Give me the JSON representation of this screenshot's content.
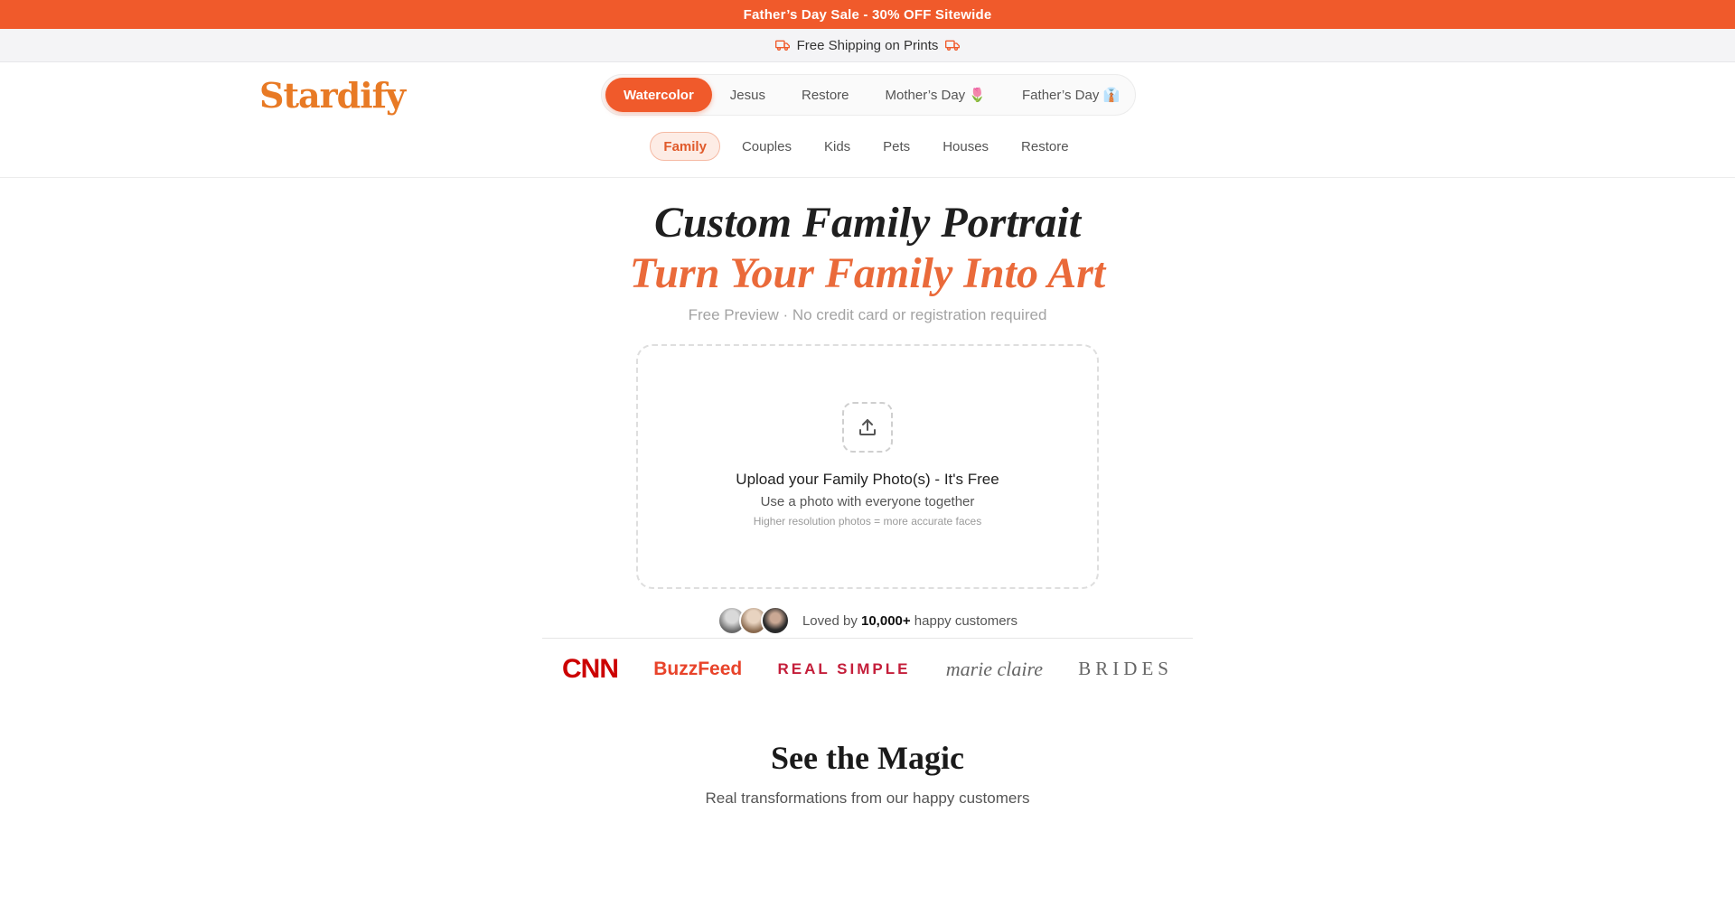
{
  "promo": {
    "text": "Father’s Day Sale - 30% OFF Sitewide"
  },
  "shipping": {
    "text": "Free Shipping on Prints"
  },
  "brand": {
    "logo": "Stardify"
  },
  "main_nav": [
    {
      "label": "Watercolor",
      "active": true
    },
    {
      "label": "Jesus"
    },
    {
      "label": "Restore"
    },
    {
      "label": "Mother’s Day 🌷"
    },
    {
      "label": "Father’s Day 👔"
    }
  ],
  "sub_nav": [
    {
      "label": "Family",
      "active": true
    },
    {
      "label": "Couples"
    },
    {
      "label": "Kids"
    },
    {
      "label": "Pets"
    },
    {
      "label": "Houses"
    },
    {
      "label": "Restore"
    }
  ],
  "hero": {
    "title": "Custom Family Portrait",
    "subtitle": "Turn Your Family Into Art",
    "note": "Free Preview · No credit card or registration required"
  },
  "upload": {
    "title": "Upload your Family Photo(s) - It's Free",
    "hint": "Use a photo with everyone together",
    "fine_print": "Higher resolution photos = more accurate faces"
  },
  "social_proof": {
    "prefix": "Loved by ",
    "count": "10,000+",
    "suffix": " happy customers"
  },
  "press": {
    "cnn": "CNN",
    "buzzfeed": "BuzzFeed",
    "real_simple": "REAL SIMPLE",
    "marie_claire": "marie claire",
    "brides": "BRIDES"
  },
  "magic": {
    "title": "See the Magic",
    "subtitle": "Real transformations from our happy customers"
  },
  "colors": {
    "accent": "#f05a2b",
    "logo": "#e87a25",
    "subtitle": "#ea6a3a"
  }
}
